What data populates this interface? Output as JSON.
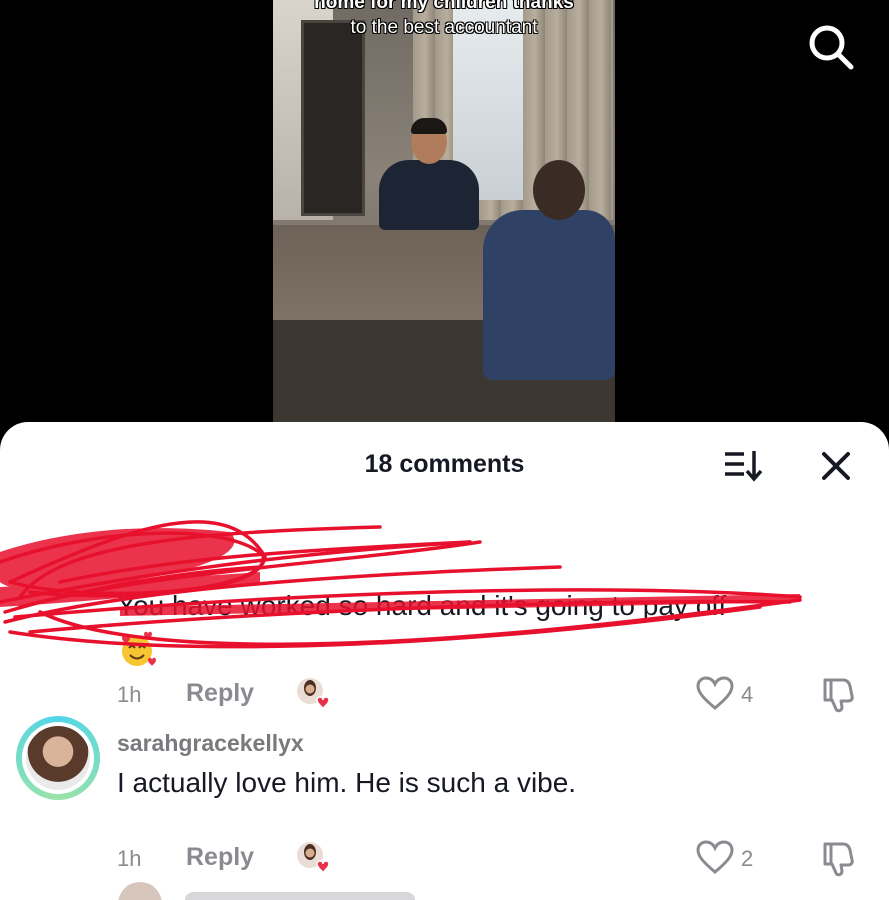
{
  "video": {
    "caption_line1": "home for my children thanks",
    "caption_line2": "to the best accountant",
    "search_icon": "search-icon"
  },
  "sheet": {
    "title": "18 comments",
    "sort_icon": "sort-icon",
    "close_icon": "close-icon"
  },
  "comments": [
    {
      "username": "",
      "text": "You have worked so hard and it's going to pay off",
      "emoji": "smiling-face-with-hearts",
      "time": "1h",
      "reply_label": "Reply",
      "likes": "4",
      "redacted": true
    },
    {
      "username": "sarahgracekellyx",
      "text": "I actually love him. He is such a vibe.",
      "time": "1h",
      "reply_label": "Reply",
      "likes": "2"
    }
  ],
  "colors": {
    "scribble": "#e8112d",
    "avatar_ring": "#4fd6e8",
    "heart": "#e8324a"
  }
}
